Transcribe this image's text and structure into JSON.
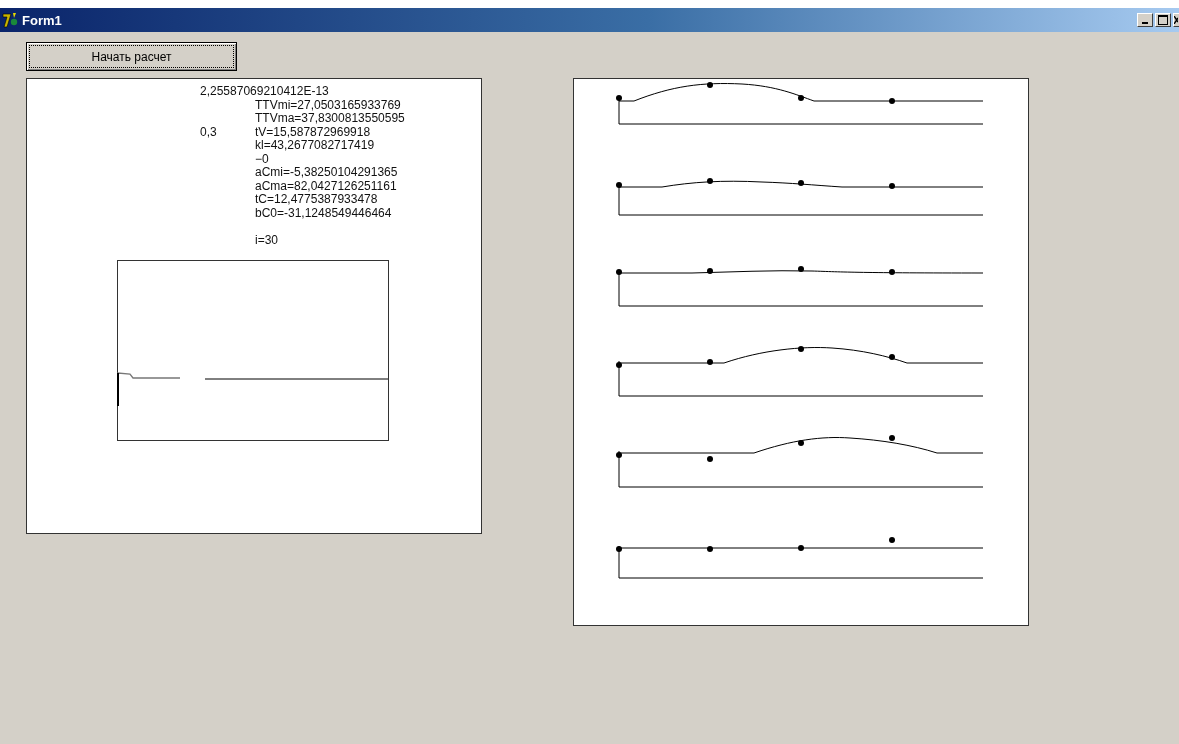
{
  "window": {
    "title": "Form1"
  },
  "start_button": {
    "label": "Начать расчет",
    "focused": true
  },
  "output_lines": [
    {
      "text": "2,25587069210412E-13",
      "kind": "wide"
    },
    {
      "text": "TTVmi=27,0503165933769"
    },
    {
      "text": "TTVma=37,8300813550595"
    },
    {
      "note": "0,3",
      "text": "tV=15,587872969918"
    },
    {
      "text": "kl=43,2677082717419"
    },
    {
      "text": "−0"
    },
    {
      "text": "aCmi=-5,38250104291365"
    },
    {
      "text": "aCma=82,0427126251161"
    },
    {
      "text": "tC=12,4775387933478"
    },
    {
      "text": "bC0=-31,1248549446464"
    },
    {
      "text": "i=30",
      "kind": "spaced"
    }
  ]
}
